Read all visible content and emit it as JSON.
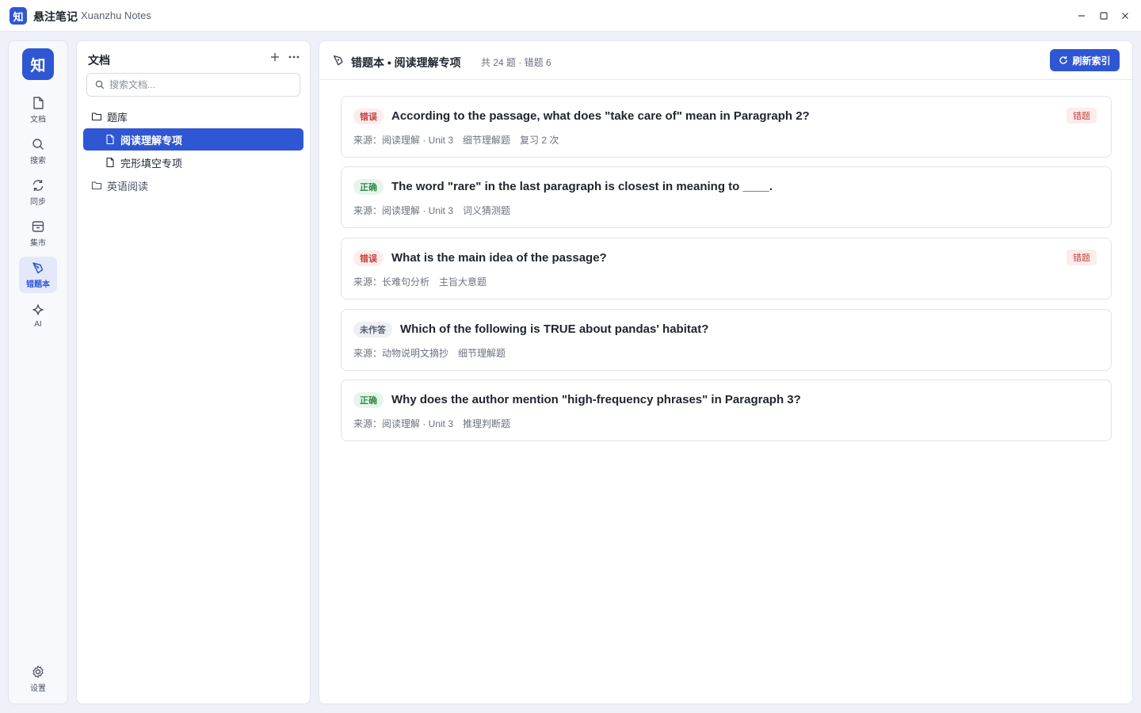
{
  "window": {
    "logo_char": "知",
    "app_name": "悬注笔记",
    "app_name_en": "Xuanzhu Notes"
  },
  "rail": {
    "logo_char": "知",
    "items": [
      {
        "label": "文档",
        "icon": "document-icon"
      },
      {
        "label": "搜索",
        "icon": "search-icon"
      },
      {
        "label": "同步",
        "icon": "sync-icon"
      },
      {
        "label": "集市",
        "icon": "market-icon"
      },
      {
        "label": "错题本",
        "icon": "pen-icon",
        "active": true
      },
      {
        "label": "AI",
        "icon": "sparkle-icon"
      }
    ],
    "settings_label": "设置"
  },
  "docs": {
    "title": "文档",
    "search_placeholder": "搜索文档...",
    "tree": [
      {
        "label": "题库",
        "type": "folder"
      },
      {
        "label": "阅读理解专项",
        "type": "file",
        "active": true
      },
      {
        "label": "完形填空专项",
        "type": "file"
      },
      {
        "label": "英语阅读",
        "type": "folder"
      }
    ]
  },
  "main": {
    "title": "错题本 • 阅读理解专项",
    "stats": "共 24 题 · 错题 6",
    "refresh_label": "刷新索引",
    "questions": [
      {
        "status": "错误",
        "status_type": "wrong",
        "text": "According to the passage, what does \"take care of\" mean in Paragraph 2?",
        "source": "来源：阅读理解 · Unit 3",
        "type": "细节理解题",
        "review": "复习 2 次",
        "tag": "错题"
      },
      {
        "status": "正确",
        "status_type": "correct",
        "text": "The word \"rare\" in the last paragraph is closest in meaning to ____.",
        "source": "来源：阅读理解 · Unit 3",
        "type": "词义猜测题",
        "review": "",
        "tag": ""
      },
      {
        "status": "错误",
        "status_type": "wrong",
        "text": "What is the main idea of the passage?",
        "source": "来源：长难句分析",
        "type": "主旨大意题",
        "review": "",
        "tag": "错题"
      },
      {
        "status": "未作答",
        "status_type": "unanswered",
        "text": "Which of the following is TRUE about pandas' habitat?",
        "source": "来源：动物说明文摘抄",
        "type": "细节理解题",
        "review": "",
        "tag": ""
      },
      {
        "status": "正确",
        "status_type": "correct",
        "text": "Why does the author mention \"high-frequency phrases\" in Paragraph 3?",
        "source": "来源：阅读理解 · Unit 3",
        "type": "推理判断题",
        "review": "",
        "tag": ""
      }
    ]
  },
  "colors": {
    "accent": "#2f56d3",
    "wrong": "#c0443e",
    "correct": "#2e8a4c"
  }
}
